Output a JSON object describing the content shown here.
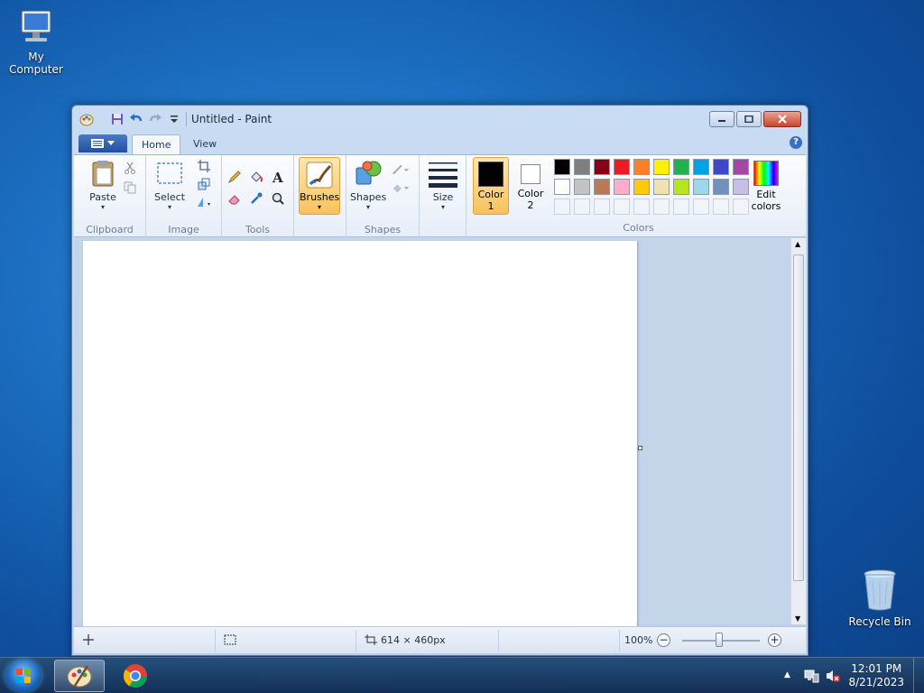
{
  "desktop": {
    "icons": [
      {
        "label": "My Computer",
        "icon": "computer-icon"
      },
      {
        "label": "Recycle Bin",
        "icon": "recycle-bin-icon"
      }
    ]
  },
  "window": {
    "title": "Untitled - Paint",
    "tabs": [
      {
        "label": "Home",
        "active": true
      },
      {
        "label": "View",
        "active": false
      }
    ],
    "help_label": "?"
  },
  "ribbon": {
    "groups": {
      "clipboard": "Clipboard",
      "image": "Image",
      "tools": "Tools",
      "shapes": "Shapes",
      "colors": "Colors"
    },
    "buttons": {
      "paste": "Paste",
      "select": "Select",
      "brushes": "Brushes",
      "shapes": "Shapes",
      "size": "Size",
      "color1_line1": "Color",
      "color1_line2": "1",
      "color2_line1": "Color",
      "color2_line2": "2",
      "edit_colors_line1": "Edit",
      "edit_colors_line2": "colors"
    },
    "color1": "#000000",
    "color2": "#ffffff",
    "palette_row1": [
      "#000000",
      "#7f7f7f",
      "#880015",
      "#ed1c24",
      "#ff7f27",
      "#fff200",
      "#22b14c",
      "#00a2e8",
      "#3f48cc",
      "#a349a4"
    ],
    "palette_row2": [
      "#ffffff",
      "#c3c3c3",
      "#b97a57",
      "#ffaec9",
      "#ffc90e",
      "#efe4b0",
      "#b5e61d",
      "#99d9ea",
      "#7092be",
      "#c8bfe7"
    ]
  },
  "statusbar": {
    "dimensions": "614 × 460px",
    "zoom": "100%",
    "zoom_minus": "−",
    "zoom_plus": "+"
  },
  "taskbar": {
    "time": "12:01 PM",
    "date": "8/21/2023"
  }
}
